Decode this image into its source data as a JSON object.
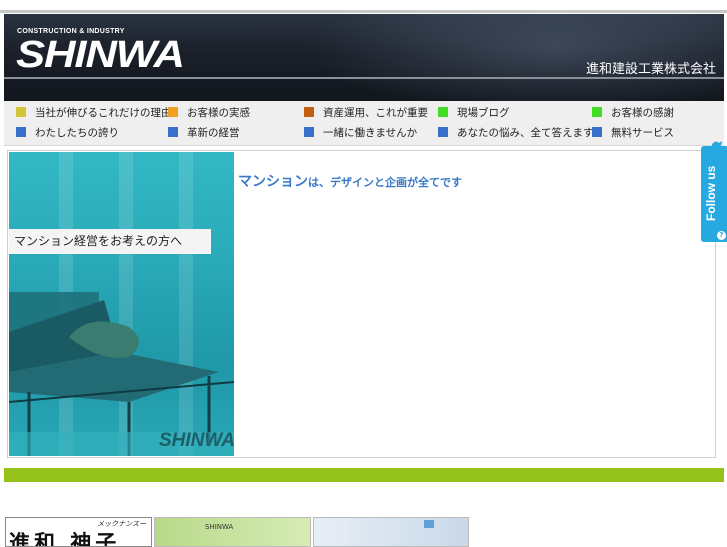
{
  "header": {
    "logo_sub": "CONSTRUCTION & INDUSTRY",
    "logo": "SHINWA",
    "company_name": "進和建設工業株式会社"
  },
  "nav": {
    "row1": [
      {
        "label": "当社が伸びるこれだけの理由",
        "color": "#d4c43a"
      },
      {
        "label": "お客様の実感",
        "color": "#f0a020"
      },
      {
        "label": "資産運用、これが重要",
        "color": "#c06010"
      },
      {
        "label": "現場ブログ",
        "color": "#44dd22"
      },
      {
        "label": "お客様の感謝",
        "color": "#44dd22"
      }
    ],
    "row2": [
      {
        "label": "わたしたちの誇り",
        "color": "#3a70cc"
      },
      {
        "label": "革新の経営",
        "color": "#3a70cc"
      },
      {
        "label": "一緒に働きませんか",
        "color": "#3a70cc"
      },
      {
        "label": "あなたの悩み、全て答えます",
        "color": "#3a70cc"
      },
      {
        "label": "無料サービス",
        "color": "#3a70cc"
      }
    ]
  },
  "hero": {
    "caption": "マンション経営をお考えの方へ",
    "logo": "SHINWA"
  },
  "headline": {
    "part1": "マンション",
    "part2": "は、",
    "part3": "デザインと企画が全てです"
  },
  "follow": {
    "label": "Follow us",
    "help": "?"
  },
  "thumbs": {
    "t1_small": "メックナンスー",
    "t1_big": "進和 神子",
    "t2_text": "SHINWA"
  },
  "colors": {
    "accent_green": "#94c21a",
    "headline_blue": "#3a78c8",
    "twitter_blue": "#26a9e0"
  }
}
